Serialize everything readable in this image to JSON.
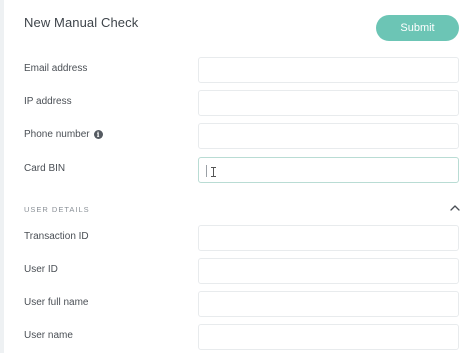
{
  "page": {
    "title": "New Manual Check"
  },
  "toolbar": {
    "submit_label": "Submit"
  },
  "fields": [
    {
      "label": "Email address",
      "value": ""
    },
    {
      "label": "IP address",
      "value": ""
    },
    {
      "label": "Phone number",
      "value": "",
      "info_icon": "info-icon"
    },
    {
      "label": "Card BIN",
      "value": ""
    }
  ],
  "user_details": {
    "header": "USER DETAILS",
    "toggle_icon": "chevron-up-icon",
    "fields": [
      {
        "label": "Transaction ID",
        "value": ""
      },
      {
        "label": "User ID",
        "value": ""
      },
      {
        "label": "User full name",
        "value": ""
      },
      {
        "label": "User name",
        "value": ""
      }
    ]
  },
  "colors": {
    "accent": "#6cc5b5",
    "text": "#4a4f55",
    "field_border": "#e8ebed",
    "focus_border": "#b9dcd4"
  }
}
